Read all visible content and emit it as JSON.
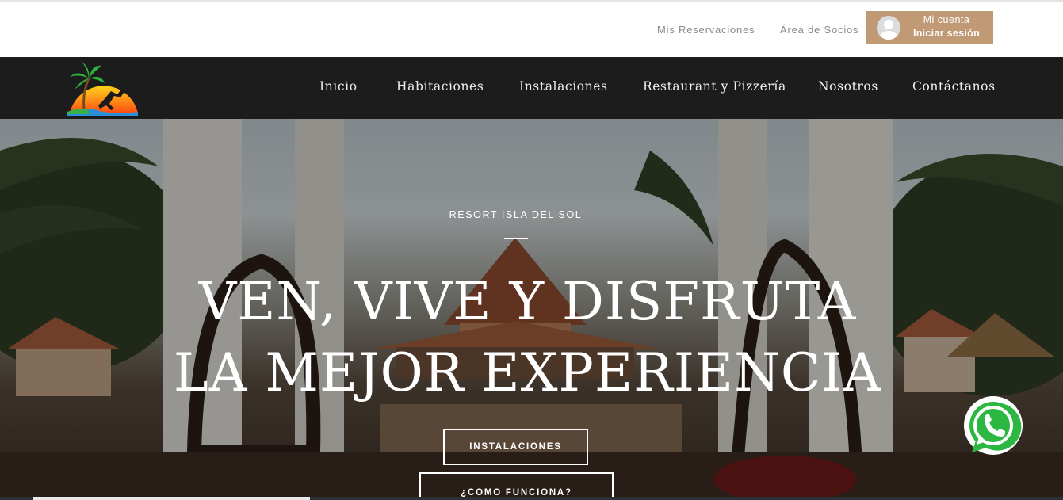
{
  "topbar": {
    "reservations_link": "Mis Reservaciones",
    "members_link": "Área de Socios",
    "account": {
      "label": "Mi cuenta",
      "action": "Iniciar sesión",
      "icon": "user-avatar-icon",
      "color": "#bf9a75"
    }
  },
  "nav": {
    "logo_icon": "palm-sunset-logo",
    "items": [
      {
        "label": "Inicio"
      },
      {
        "label": "Habitaciones"
      },
      {
        "label": "Instalaciones"
      },
      {
        "label": "Restaurant y Pizzería"
      },
      {
        "label": "Nosotros"
      },
      {
        "label": "Contáctanos"
      }
    ],
    "background": "#1c1c1c"
  },
  "hero": {
    "kicker": "RESORT ISLA DEL SOL",
    "headline_line1": "VEN, VIVE Y DISFRUTA",
    "headline_line2": "LA MEJOR EXPERIENCIA",
    "buttons": {
      "primary": "INSTALACIONES",
      "secondary": "¿COMO FUNCIONA?"
    },
    "slider_progress": 0.26
  },
  "whatsapp": {
    "icon": "whatsapp-icon",
    "color": "#2bb741"
  }
}
